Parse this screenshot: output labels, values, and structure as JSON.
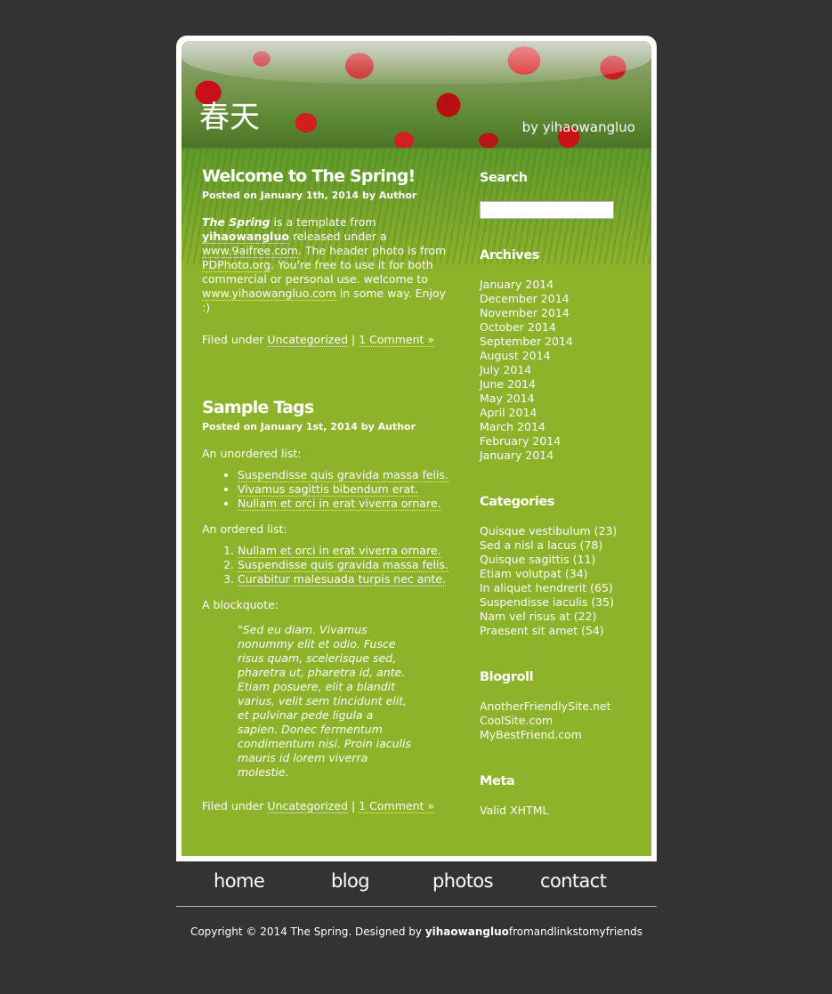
{
  "header": {
    "title": "春天",
    "byline": "by yihaowangluo"
  },
  "posts": [
    {
      "title": "Welcome to The Spring!",
      "meta": "Posted on January 1th, 2014 by Author",
      "body": {
        "template_name": "The Spring",
        "t1": " is a template from ",
        "author_link": "yihaowangluo",
        "t2": " released under a ",
        "license_link": "www.9aifree.com",
        "t3": ". The header photo is from ",
        "photo_link": "PDPhoto.org",
        "t4": ". You're free to use it for both commercial or personal use. welcome to ",
        "site_link": "www.yihaowangluo.com",
        "t5": " in some way. Enjoy :)"
      },
      "filed_prefix": "Filed under",
      "category": "Uncategorized",
      "separator": "|",
      "comments": "1 Comment »"
    },
    {
      "title": "Sample Tags",
      "meta": "Posted on January 1st, 2014 by Author",
      "unordered_label": "An unordered list:",
      "unordered": [
        "Suspendisse quis gravida massa felis.",
        "Vivamus sagittis bibendum erat.",
        "Nullam et orci in erat viverra ornare."
      ],
      "ordered_label": "An ordered list:",
      "ordered": [
        "Nullam et orci in erat viverra ornare.",
        "Suspendisse quis gravida massa felis.",
        "Curabitur malesuada turpis nec ante."
      ],
      "blockquote_label": "A blockquote:",
      "blockquote": "\"Sed eu diam. Vivamus nonummy elit et odio. Fusce risus quam, scelerisque sed, pharetra ut, pharetra id, ante. Etiam posuere, elit a blandit varius, velit sem tincidunt elit, et pulvinar pede ligula a sapien. Donec fermentum condimentum nisi. Proin iaculis mauris id lorem viverra molestie.",
      "filed_prefix": "Filed under",
      "category": "Uncategorized",
      "separator": "|",
      "comments": "1 Comment »"
    }
  ],
  "sidebar": {
    "search_title": "Search",
    "search_value": "",
    "archives_title": "Archives",
    "archives": [
      "January 2014",
      "December 2014",
      "November 2014",
      "October 2014",
      "September 2014",
      "August 2014",
      "July 2014",
      "June 2014",
      "May 2014",
      "April 2014",
      "March 2014",
      "February 2014",
      "January 2014"
    ],
    "categories_title": "Categories",
    "categories": [
      "Quisque vestibulum (23)",
      "Sed a nisl a lacus (78)",
      "Quisque sagittis (11)",
      "Etiam volutpat (34)",
      "In aliquet hendrerit (65)",
      "Suspendisse iaculis (35)",
      "Nam vel risus at (22)",
      "Praesent sit amet (54)"
    ],
    "blogroll_title": "Blogroll",
    "blogroll": [
      "AnotherFriendlySite.net",
      "CoolSite.com",
      "MyBestFriend.com"
    ],
    "meta_title": "Meta",
    "meta": [
      "Valid XHTML"
    ]
  },
  "nav": [
    "home",
    "blog",
    "photos",
    "contact"
  ],
  "footer": {
    "prefix": "Copyright © 2014 The Spring. Designed by ",
    "designer": "yihaowangluo",
    "suffix": "fromandlinkstomyfriends"
  },
  "colors": {
    "page_background": "#333333",
    "content_green": "#8db32b",
    "frame_white": "#ffffff"
  }
}
